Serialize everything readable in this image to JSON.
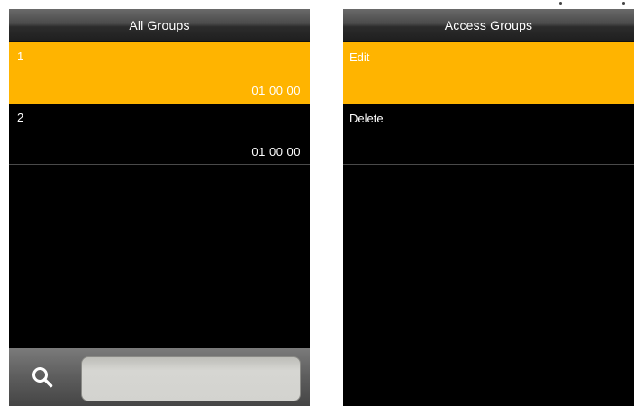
{
  "left_screen": {
    "title": "All Groups",
    "rows": [
      {
        "label": "1",
        "value": "01 00 00",
        "selected": true
      },
      {
        "label": "2",
        "value": "01 00 00",
        "selected": false
      }
    ],
    "search": {
      "icon": "search-icon",
      "value": ""
    }
  },
  "right_screen": {
    "title": "Access Groups",
    "items": [
      {
        "label": "Edit",
        "selected": true
      },
      {
        "label": "Delete",
        "selected": false
      }
    ]
  },
  "colors": {
    "highlight": "#ffb400",
    "background": "#000000",
    "text": "#ffffff"
  }
}
